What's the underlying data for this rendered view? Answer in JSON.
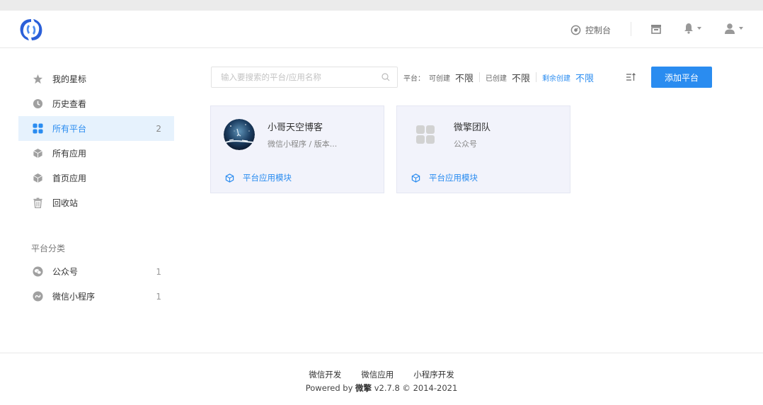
{
  "header": {
    "console_label": "控制台"
  },
  "sidebar": {
    "items": [
      {
        "label": "我的星标",
        "icon": "star-icon",
        "count": ""
      },
      {
        "label": "历史查看",
        "icon": "clock-icon",
        "count": ""
      },
      {
        "label": "所有平台",
        "icon": "grid-icon",
        "count": "2",
        "active": true
      },
      {
        "label": "所有应用",
        "icon": "cube-icon",
        "count": ""
      },
      {
        "label": "首页应用",
        "icon": "cube-icon",
        "count": ""
      },
      {
        "label": "回收站",
        "icon": "trash-icon",
        "count": ""
      }
    ],
    "group_title": "平台分类",
    "categories": [
      {
        "label": "公众号",
        "icon": "wechat-icon",
        "count": "1"
      },
      {
        "label": "微信小程序",
        "icon": "miniprogram-icon",
        "count": "1"
      }
    ]
  },
  "toolbar": {
    "search_placeholder": "输入要搜索的平台/应用名称",
    "platform_label": "平台：",
    "can_create_label": "可创建",
    "can_create_value": "不限",
    "created_label": "已创建",
    "created_value": "不限",
    "remaining_label": "剩余创建",
    "remaining_value": "不限",
    "add_button": "添加平台"
  },
  "cards": [
    {
      "name": "小哥天空博客",
      "subtitle": "微信小程序 / 版本...",
      "module": "平台应用模块"
    },
    {
      "name": "微擎团队",
      "subtitle": "公众号",
      "module": "平台应用模块"
    }
  ],
  "footer": {
    "links": [
      "微信开发",
      "微信应用",
      "小程序开发"
    ],
    "powered_prefix": "Powered by ",
    "brand": "微擎",
    "powered_suffix": " v2.7.8 © 2014-2021"
  },
  "colors": {
    "accent": "#2a8cf0",
    "active_bg": "#e6f2fd",
    "card_bg": "#f2f3fb"
  }
}
